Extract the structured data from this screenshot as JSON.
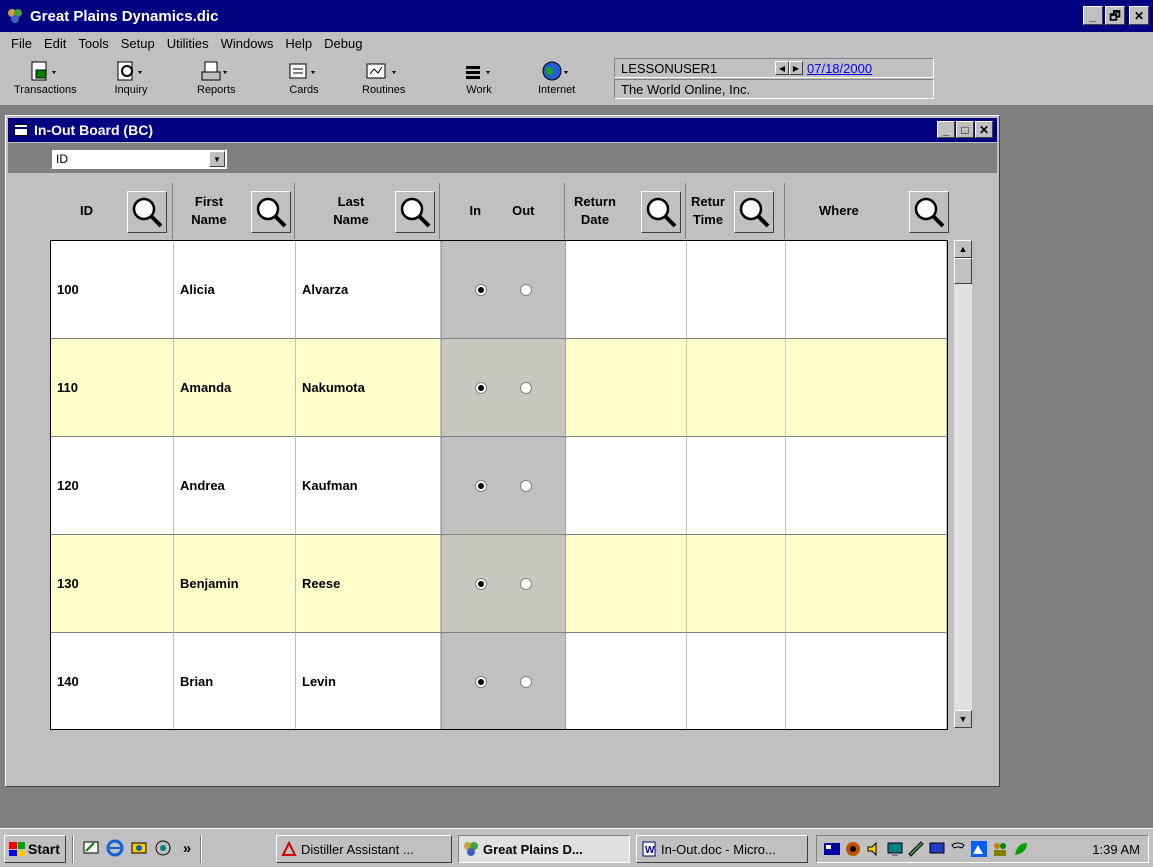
{
  "app": {
    "title": "Great Plains Dynamics.dic",
    "window_buttons": {
      "minimize": "_",
      "maximize": "🗗",
      "close": "✕"
    }
  },
  "menu": [
    "File",
    "Edit",
    "Tools",
    "Setup",
    "Utilities",
    "Windows",
    "Help",
    "Debug"
  ],
  "toolbar": {
    "buttons": [
      {
        "label": "Transactions",
        "icon": "transactions-icon"
      },
      {
        "label": "Inquiry",
        "icon": "inquiry-icon"
      },
      {
        "label": "Reports",
        "icon": "reports-icon"
      },
      {
        "label": "Cards",
        "icon": "cards-icon"
      },
      {
        "label": "Routines",
        "icon": "routines-icon"
      },
      {
        "label": "Work",
        "icon": "work-icon"
      },
      {
        "label": "Internet",
        "icon": "internet-globe-icon"
      }
    ],
    "user": "LESSONUSER1",
    "date": "07/18/2000",
    "company": "The World Online, Inc."
  },
  "child_window": {
    "title": "In-Out Board (BC)",
    "sort_by": "ID",
    "columns": {
      "id": "ID",
      "first_name": "First Name",
      "last_name": "Last Name",
      "in": "In",
      "out": "Out",
      "return_date": "Return Date",
      "return_time": "Retur Time",
      "where": "Where"
    },
    "rows": [
      {
        "id": "100",
        "first": "Alicia",
        "last": "Alvarza",
        "status": "in",
        "return_date": "",
        "return_time": "",
        "where": ""
      },
      {
        "id": "110",
        "first": "Amanda",
        "last": "Nakumota",
        "status": "in",
        "return_date": "",
        "return_time": "",
        "where": ""
      },
      {
        "id": "120",
        "first": "Andrea",
        "last": "Kaufman",
        "status": "in",
        "return_date": "",
        "return_time": "",
        "where": ""
      },
      {
        "id": "130",
        "first": "Benjamin",
        "last": "Reese",
        "status": "in",
        "return_date": "",
        "return_time": "",
        "where": ""
      },
      {
        "id": "140",
        "first": "Brian",
        "last": "Levin",
        "status": "in",
        "return_date": "",
        "return_time": "",
        "where": ""
      }
    ]
  },
  "taskbar": {
    "start": "Start",
    "chevron": "»",
    "tasks": [
      {
        "label": "Distiller Assistant ...",
        "active": false
      },
      {
        "label": "Great Plains D...",
        "active": true
      },
      {
        "label": "In-Out.doc - Micro...",
        "active": false
      }
    ],
    "clock": "1:39 AM"
  },
  "colors": {
    "title_bar": "#000080",
    "face": "#c0c0c0",
    "alt_row": "#ffffcc",
    "desktop": "#808080",
    "link": "#0000ff"
  }
}
